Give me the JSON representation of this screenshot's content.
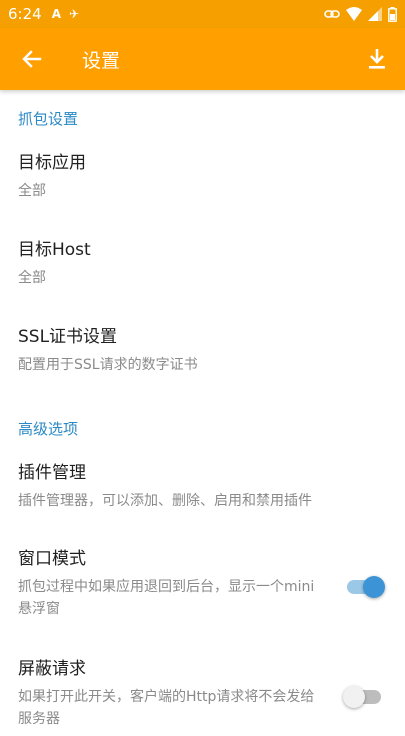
{
  "status_bar": {
    "time": "6:24",
    "left_icons": [
      "A",
      "✈"
    ],
    "right_icons": [
      "link-icon",
      "wifi-icon",
      "signal-icon",
      "battery-icon"
    ]
  },
  "app_bar": {
    "title": "设置",
    "back_icon": "arrow-left-icon",
    "action_icon": "download-icon"
  },
  "sections": [
    {
      "header": "抓包设置",
      "items": [
        {
          "title": "目标应用",
          "summary": "全部"
        },
        {
          "title": "目标Host",
          "summary": "全部"
        },
        {
          "title": "SSL证书设置",
          "summary": "配置用于SSL请求的数字证书"
        }
      ]
    },
    {
      "header": "高级选项",
      "items": [
        {
          "title": "插件管理",
          "summary": "插件管理器，可以添加、删除、启用和禁用插件"
        },
        {
          "title": "窗口模式",
          "summary": "抓包过程中如果应用退回到后台，显示一个mini悬浮窗",
          "switch": "on"
        },
        {
          "title": "屏蔽请求",
          "summary": "如果打开此开关，客户端的Http请求将不会发给服务器",
          "switch": "off"
        }
      ]
    }
  ],
  "colors": {
    "app_bar": "#ff9f00",
    "accent": "#2b8ac6",
    "switch_on": "#3c94d6"
  }
}
